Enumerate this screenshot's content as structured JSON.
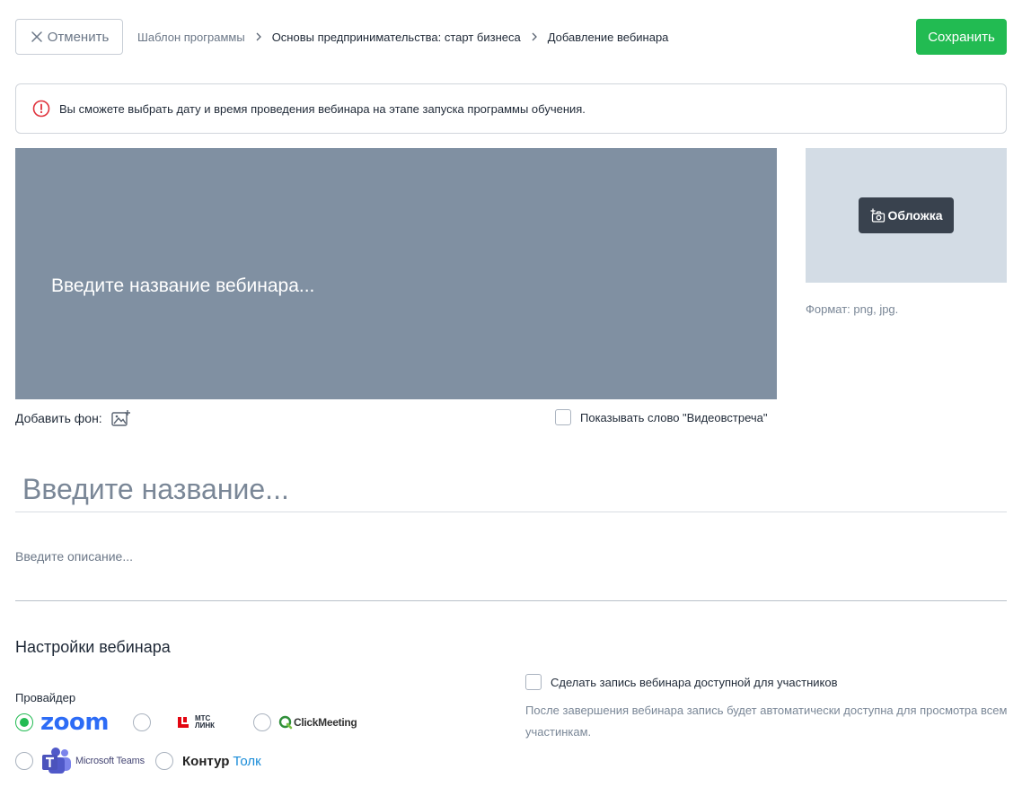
{
  "header": {
    "cancel_label": "Отменить",
    "save_label": "Сохранить",
    "breadcrumb": [
      "Шаблон программы",
      "Основы предпринимательства: старт бизнеса",
      "Добавление вебинара"
    ]
  },
  "notice": {
    "text": "Вы сможете выбрать дату и время проведения вебинара на этапе запуска программы обучения."
  },
  "banner": {
    "title_placeholder": "Введите название вебинара...",
    "add_background_label": "Добавить фон:",
    "show_word_label": "Показывать слово \"Видеовстреча\""
  },
  "cover": {
    "button_label": "Обложка",
    "format_text": "Формат: png, jpg."
  },
  "form": {
    "title_placeholder": "Введите название...",
    "description_placeholder": "Введите описание..."
  },
  "settings": {
    "title": "Настройки вебинара",
    "provider_label": "Провайдер",
    "selected_provider": "zoom",
    "providers": [
      {
        "id": "zoom",
        "name": "zoom"
      },
      {
        "id": "mts",
        "name": "МТС ЛИНК"
      },
      {
        "id": "clickmeeting",
        "name": "ClickMeeting"
      },
      {
        "id": "teams",
        "name": "Microsoft Teams"
      },
      {
        "id": "kontur",
        "name_a": "Контур",
        "name_b": "Толк"
      }
    ],
    "record_label": "Сделать запись вебинара доступной для участников",
    "record_hint": "После завершения вебинара запись будет автоматически доступна для просмотра всем участинкам."
  },
  "colors": {
    "accent_green": "#22bb52",
    "banner_bg": "#8090a2",
    "cover_bg": "#d3dce5",
    "error_red": "#e0323c",
    "zoom_blue": "#2d6cf6",
    "teams_purple": "#5059c9",
    "mts_red": "#e30611"
  }
}
